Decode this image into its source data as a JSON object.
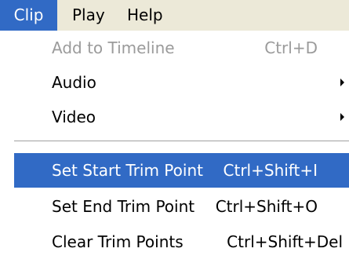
{
  "menubar": {
    "items": [
      {
        "label": "Clip",
        "active": true
      },
      {
        "label": "Play",
        "active": false
      },
      {
        "label": "Help",
        "active": false
      }
    ]
  },
  "clip_menu": {
    "items": [
      {
        "label": "Add to Timeline",
        "shortcut": "Ctrl+D",
        "enabled": false
      },
      {
        "label": "Audio",
        "submenu": true
      },
      {
        "label": "Video",
        "submenu": true
      },
      {
        "label": "Set Start Trim Point",
        "shortcut": "Ctrl+Shift+I",
        "highlighted": true
      },
      {
        "label": "Set End Trim Point",
        "shortcut": "Ctrl+Shift+O"
      },
      {
        "label": "Clear Trim Points",
        "shortcut": "Ctrl+Shift+Del"
      }
    ]
  },
  "colors": {
    "menubar_bg": "#ece9d8",
    "highlight": "#316ac5",
    "disabled_text": "#9b9b9b"
  }
}
